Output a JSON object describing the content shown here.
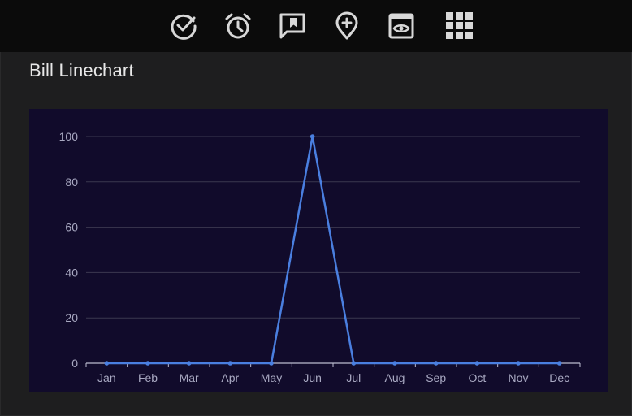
{
  "toolbar": {
    "icons": [
      {
        "name": "check-circle-icon"
      },
      {
        "name": "alarm-clock-icon"
      },
      {
        "name": "comment-bookmark-icon"
      },
      {
        "name": "location-add-icon"
      },
      {
        "name": "preview-window-icon"
      },
      {
        "name": "apps-grid-icon"
      }
    ],
    "icon_color": "#d8d8d8"
  },
  "card": {
    "title": "Bill Linechart"
  },
  "colors": {
    "chart_bg": "#110b2b",
    "line": "#4a7fe0",
    "grid": "#3b3950",
    "axis": "#bdbdd0"
  },
  "chart_data": {
    "type": "line",
    "title": "",
    "xlabel": "",
    "ylabel": "",
    "categories": [
      "Jan",
      "Feb",
      "Mar",
      "Apr",
      "May",
      "Jun",
      "Jul",
      "Aug",
      "Sep",
      "Oct",
      "Nov",
      "Dec"
    ],
    "series": [
      {
        "values": [
          0,
          0,
          0,
          0,
          0,
          100,
          0,
          0,
          0,
          0,
          0,
          0
        ]
      }
    ],
    "ylim": [
      0,
      100
    ],
    "yticks": [
      0,
      20,
      40,
      60,
      80,
      100
    ],
    "grid": true
  }
}
